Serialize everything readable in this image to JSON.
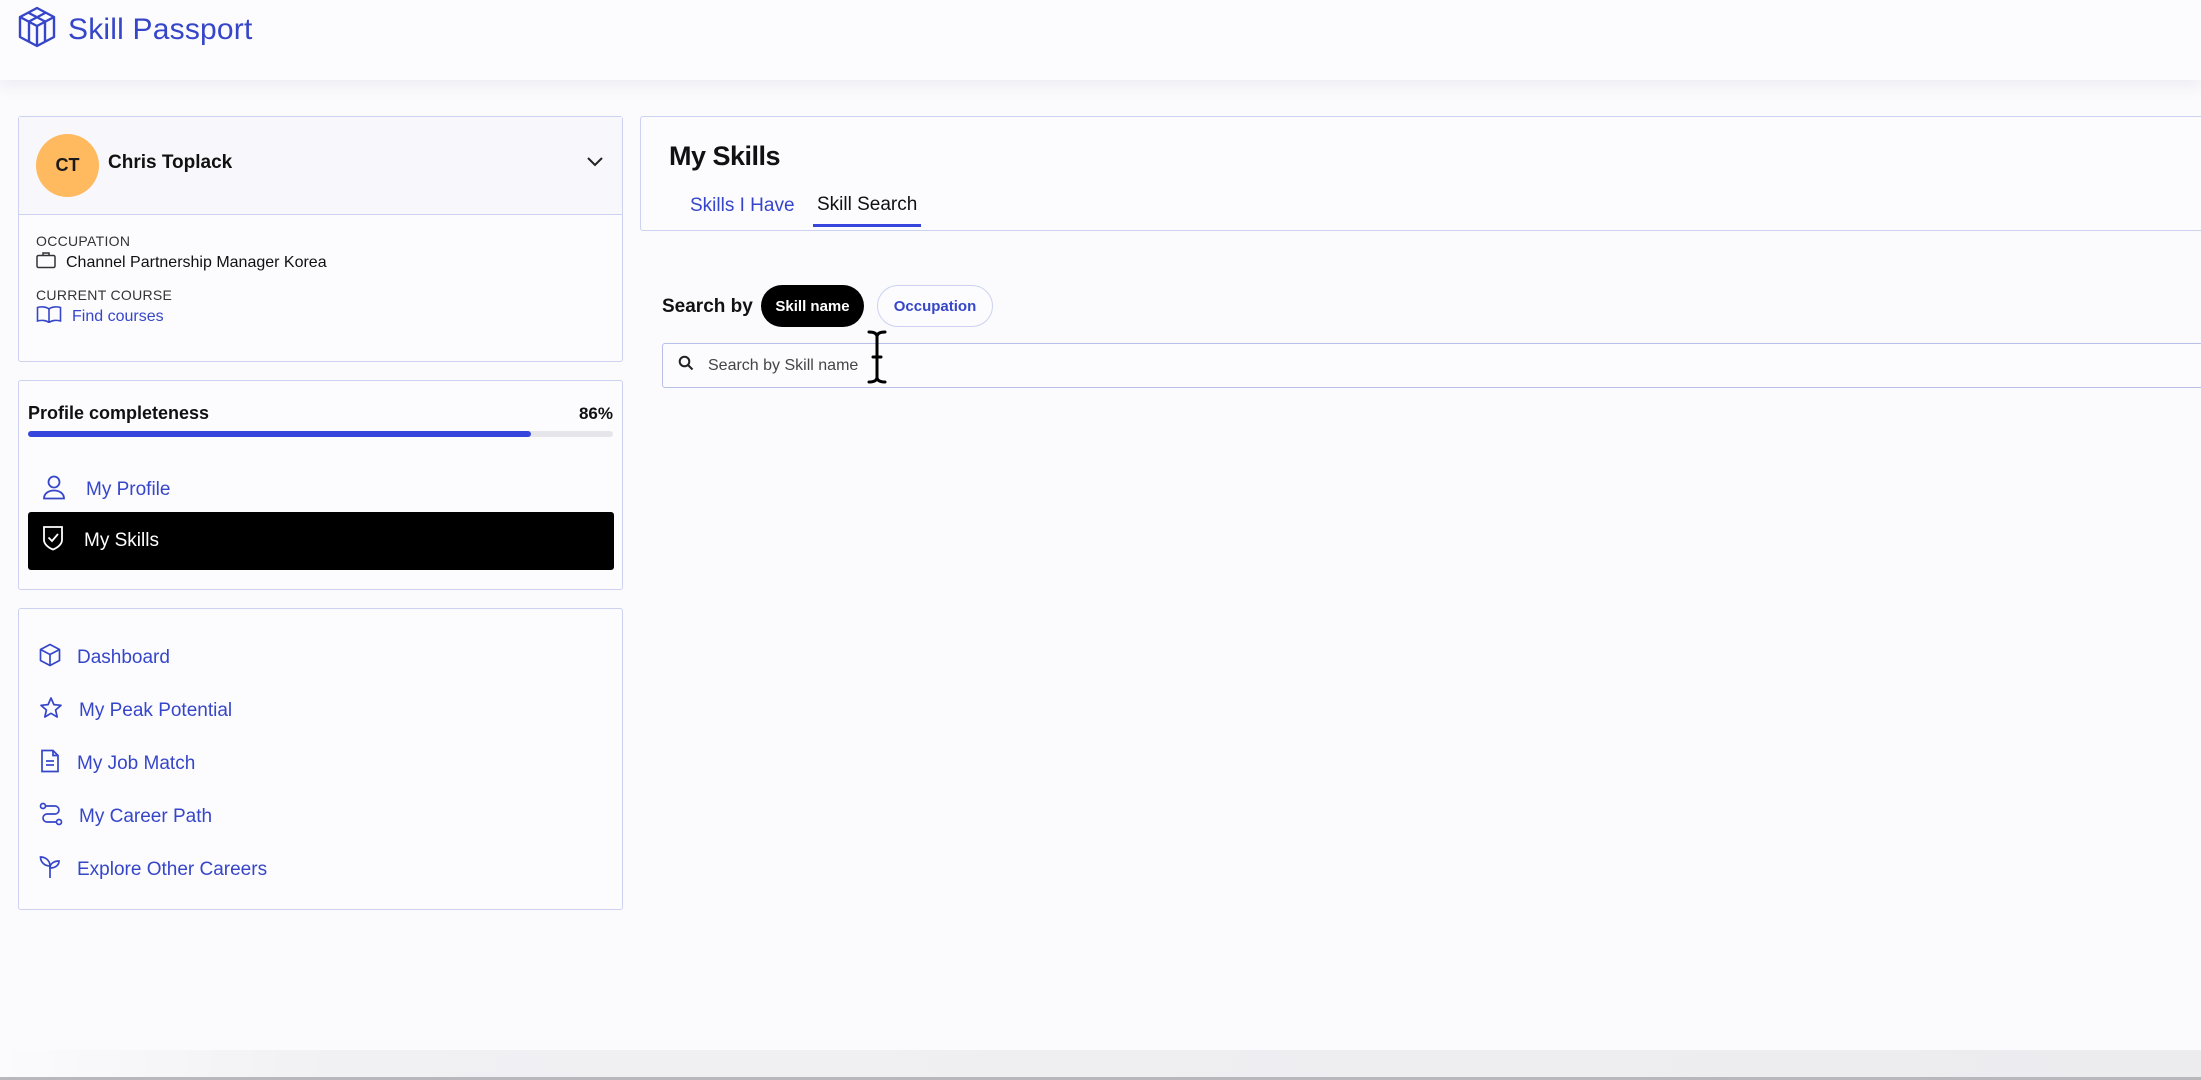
{
  "app": {
    "name": "Skill Passport",
    "accent": "#3646c8"
  },
  "profile": {
    "initials": "CT",
    "name": "Chris Toplack",
    "occupation_label": "OCCUPATION",
    "occupation": "Channel Partnership Manager Korea",
    "course_label": "CURRENT COURSE",
    "course_link": "Find courses"
  },
  "completeness": {
    "title": "Profile completeness",
    "percent_label": "86%",
    "progress": 0.86,
    "nav": [
      {
        "label": "My Profile",
        "icon": "person-icon",
        "active": false
      },
      {
        "label": "My Skills",
        "icon": "shield-check-icon",
        "active": true
      }
    ]
  },
  "links": [
    {
      "label": "Dashboard",
      "icon": "cube-icon"
    },
    {
      "label": "My Peak Potential",
      "icon": "star-icon"
    },
    {
      "label": "My Job Match",
      "icon": "document-icon"
    },
    {
      "label": "My Career Path",
      "icon": "route-icon"
    },
    {
      "label": "Explore Other Careers",
      "icon": "sprout-icon"
    }
  ],
  "main": {
    "title": "My Skills",
    "tabs": [
      {
        "label": "Skills I Have",
        "active": false
      },
      {
        "label": "Skill Search",
        "active": true
      }
    ],
    "search_by_label": "Search by",
    "filters": [
      {
        "label": "Skill name",
        "selected": true
      },
      {
        "label": "Occupation",
        "selected": false
      }
    ],
    "search": {
      "placeholder": "Search by Skill name",
      "value": ""
    }
  }
}
